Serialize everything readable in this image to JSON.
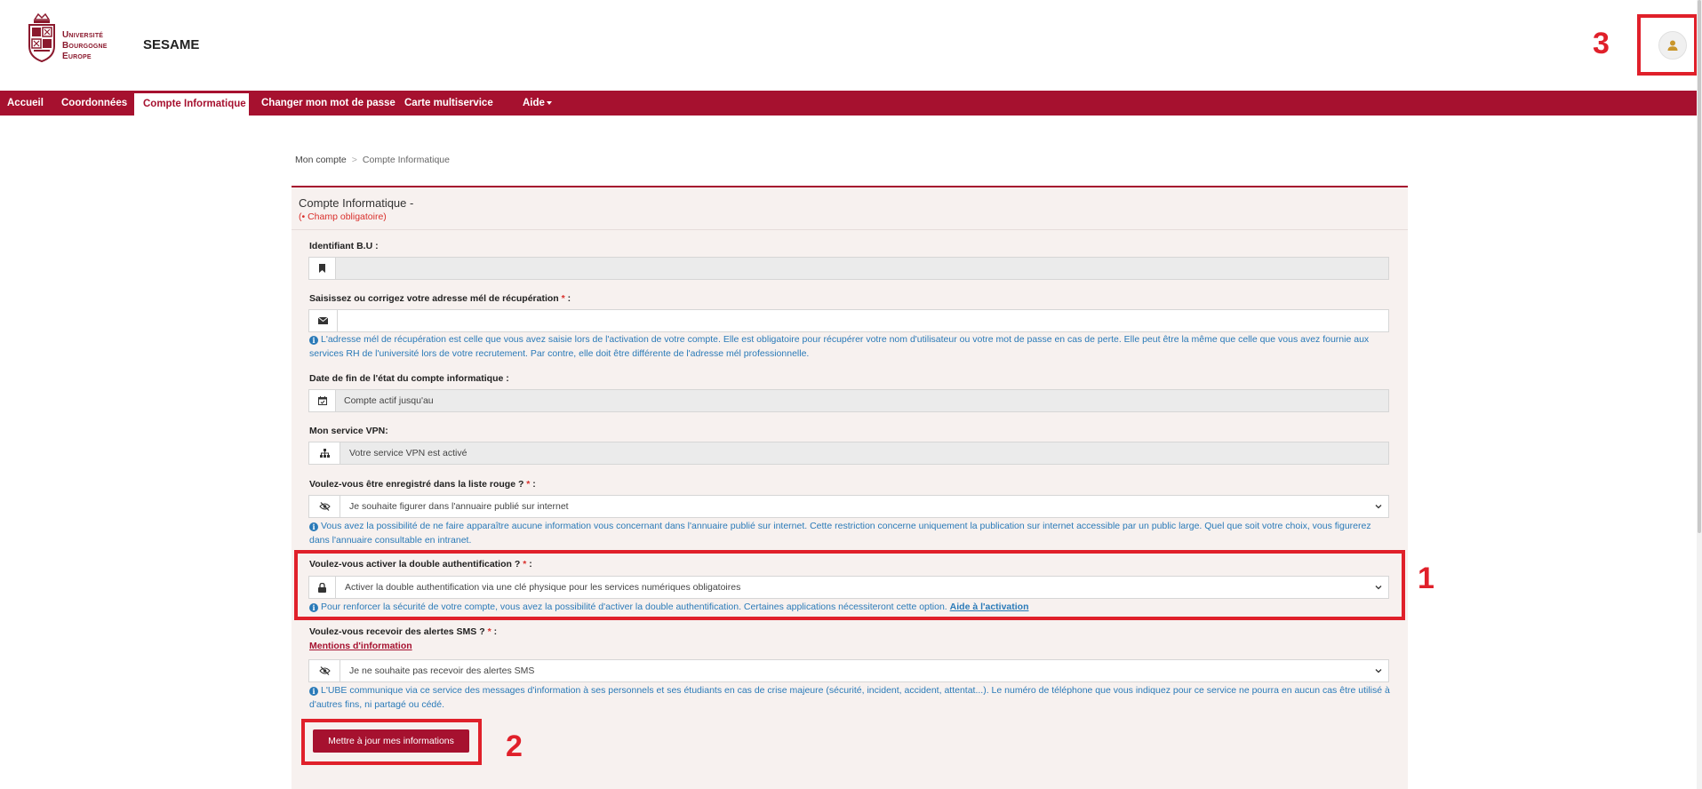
{
  "header": {
    "logo_lines": [
      "Université",
      "Bourgogne",
      "Europe"
    ],
    "app_name": "SESAME",
    "user_icon": "user-icon"
  },
  "nav": {
    "items": [
      {
        "label": "Accueil"
      },
      {
        "label": "Coordonnées"
      },
      {
        "label": "Compte Informatique",
        "active": true
      },
      {
        "label": "Changer mon mot de passe"
      },
      {
        "label": "Carte multiservice"
      },
      {
        "label": "Aide"
      }
    ]
  },
  "breadcrumb": {
    "root": "Mon compte",
    "separator": ">",
    "current": "Compte Informatique"
  },
  "card": {
    "title": "Compte Informatique -",
    "required_note": "(• Champ obligatoire)"
  },
  "fields": {
    "identifiant": {
      "label": "Identifiant B.U :",
      "value": "",
      "icon": "bookmark-icon"
    },
    "email": {
      "label": "Saisissez ou corrigez votre adresse mél de récupération",
      "required_mark": "*",
      "suffix": " :",
      "value": "",
      "icon": "envelope-icon",
      "help": "L'adresse mél de récupération est celle que vous avez saisie lors de l'activation de votre compte. Elle est obligatoire pour récupérer votre nom d'utilisateur ou votre mot de passe en cas de perte. Elle peut être la même que celle que vous avez fournie aux services RH de l'université lors de votre recrutement. Par contre, elle doit être différente de l'adresse mél professionnelle."
    },
    "date_fin": {
      "label": "Date de fin de l'état du compte informatique :",
      "value": "Compte actif jusqu'au",
      "icon": "calendar-icon"
    },
    "vpn": {
      "label": "Mon service VPN:",
      "value": "Votre service VPN est activé",
      "icon": "sitemap-icon"
    },
    "liste_rouge": {
      "label": "Voulez-vous être enregistré dans la liste rouge ?",
      "required_mark": "*",
      "suffix": " :",
      "value": "Je souhaite figurer dans l'annuaire publié sur internet",
      "icon": "eye-slash-icon",
      "help": "Vous avez la possibilité de ne faire apparaître aucune information vous concernant dans l'annuaire publié sur internet. Cette restriction concerne uniquement la publication sur internet accessible par un public large. Quel que soit votre choix, vous figurerez dans l'annuaire consultable en intranet."
    },
    "double_auth": {
      "label": "Voulez-vous activer la double authentification ?",
      "required_mark": "*",
      "suffix": " :",
      "value": "Activer la double authentification via une clé physique pour les services numériques obligatoires",
      "icon": "lock-icon",
      "help": "Pour renforcer la sécurité de votre compte, vous avez la possibilité d'activer la double authentification. Certaines applications nécessiteront cette option.",
      "help_link": "Aide à l'activation"
    },
    "sms": {
      "label": "Voulez-vous recevoir des alertes SMS ?",
      "required_mark": "*",
      "suffix": " :",
      "mentions": "Mentions d'information",
      "value": "Je ne souhaite pas recevoir des alertes SMS",
      "icon": "eye-slash-icon",
      "help": "L'UBE communique via ce service des messages d'information à ses personnels et ses étudiants en cas de crise majeure (sécurité, incident, accident, attentat...). Le numéro de téléphone que vous indiquez pour ce service ne pourra en aucun cas être utilisé à d'autres fins, ni partagé ou cédé."
    }
  },
  "submit_label": "Mettre à jour mes informations",
  "annotations": [
    "1",
    "2",
    "3"
  ],
  "colors": {
    "brand": "#a6112f",
    "annotation": "#e0202a",
    "help_text": "#2a7ab8",
    "required": "#d9302c"
  }
}
